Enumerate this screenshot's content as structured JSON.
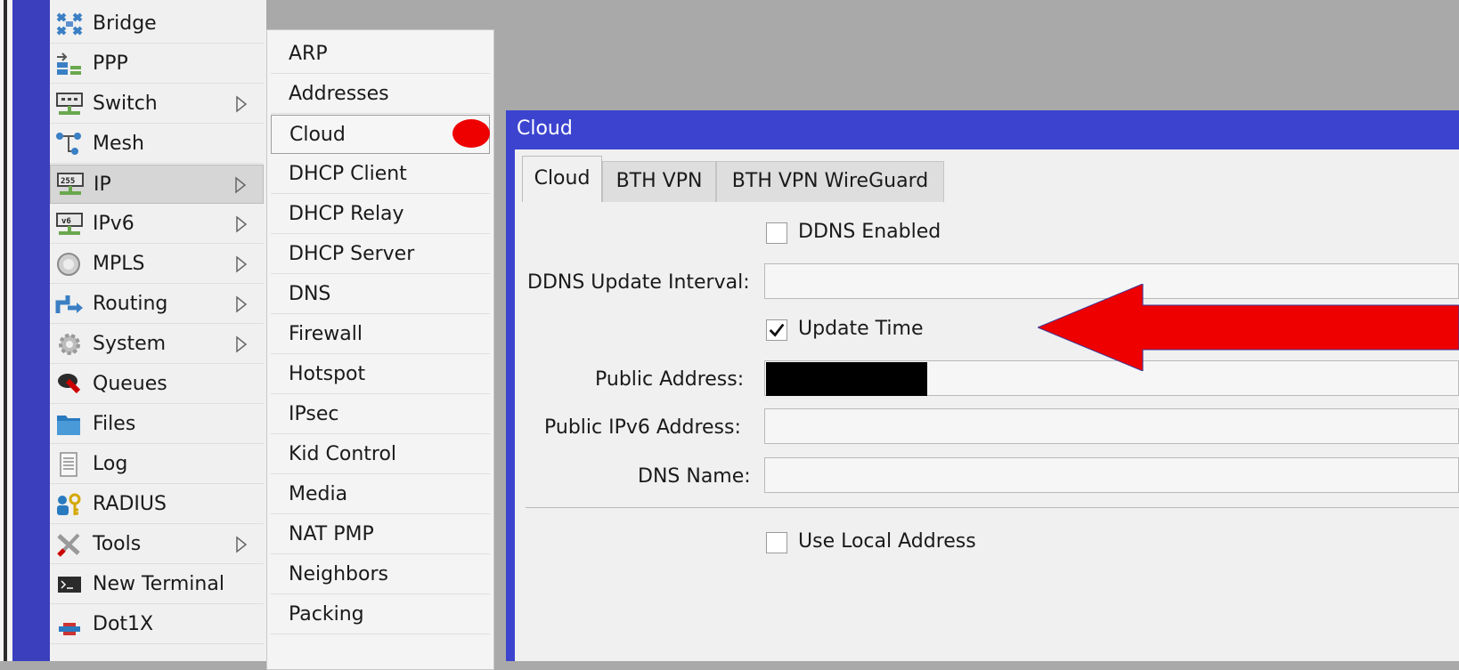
{
  "main_menu": {
    "items": [
      {
        "label": "Bridge",
        "icon": "bridge-icon",
        "has_submenu": false
      },
      {
        "label": "PPP",
        "icon": "ppp-icon",
        "has_submenu": false
      },
      {
        "label": "Switch",
        "icon": "switch-icon",
        "has_submenu": true
      },
      {
        "label": "Mesh",
        "icon": "mesh-icon",
        "has_submenu": false
      },
      {
        "label": "IP",
        "icon": "ip-icon",
        "has_submenu": true,
        "selected": true
      },
      {
        "label": "IPv6",
        "icon": "ipv6-icon",
        "has_submenu": true
      },
      {
        "label": "MPLS",
        "icon": "mpls-icon",
        "has_submenu": true
      },
      {
        "label": "Routing",
        "icon": "routing-icon",
        "has_submenu": true
      },
      {
        "label": "System",
        "icon": "system-gear-icon",
        "has_submenu": true
      },
      {
        "label": "Queues",
        "icon": "queues-icon",
        "has_submenu": false
      },
      {
        "label": "Files",
        "icon": "folder-icon",
        "has_submenu": false
      },
      {
        "label": "Log",
        "icon": "log-icon",
        "has_submenu": false
      },
      {
        "label": "RADIUS",
        "icon": "radius-icon",
        "has_submenu": false
      },
      {
        "label": "Tools",
        "icon": "tools-icon",
        "has_submenu": true
      },
      {
        "label": "New Terminal",
        "icon": "terminal-icon",
        "has_submenu": false
      },
      {
        "label": "Dot1X",
        "icon": "dot1x-icon",
        "has_submenu": false
      }
    ]
  },
  "ip_submenu": {
    "items": [
      "ARP",
      "Addresses",
      "Cloud",
      "DHCP Client",
      "DHCP Relay",
      "DHCP Server",
      "DNS",
      "Firewall",
      "Hotspot",
      "IPsec",
      "Kid Control",
      "Media",
      "NAT PMP",
      "Neighbors",
      "Packing"
    ],
    "highlighted": "Cloud"
  },
  "cloud_window": {
    "title": "Cloud",
    "tabs": [
      "Cloud",
      "BTH VPN",
      "BTH VPN WireGuard"
    ],
    "active_tab": "Cloud",
    "ddns_enabled": {
      "label": "DDNS Enabled",
      "checked": false
    },
    "ddns_update_interval": {
      "label": "DDNS Update Interval:",
      "value": ""
    },
    "update_time": {
      "label": "Update Time",
      "checked": true
    },
    "public_address": {
      "label": "Public Address:",
      "value": "",
      "redacted": true
    },
    "public_ipv6_address": {
      "label": "Public IPv6 Address:",
      "value": ""
    },
    "dns_name": {
      "label": "DNS Name:",
      "value": ""
    },
    "use_local_address": {
      "label": "Use Local Address",
      "checked": false
    }
  },
  "colors": {
    "menu_strip": "#3b3fbe",
    "window_titlebar": "#3c44cf",
    "annotation_red": "#ee0000"
  }
}
